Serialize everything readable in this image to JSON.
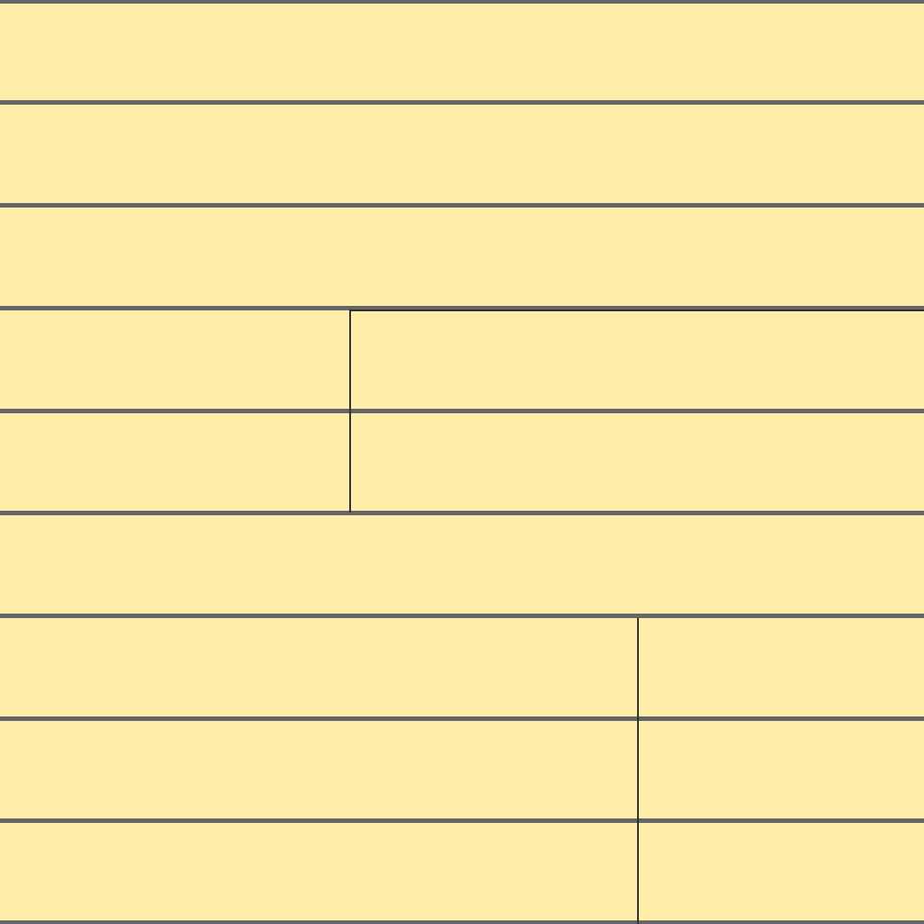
{
  "colors": {
    "background": "#ffedaa",
    "rule": "#666666",
    "divider": "#333333"
  },
  "rules": [
    "r0",
    "r1",
    "r2",
    "r3",
    "r4",
    "r5",
    "r6",
    "r7",
    "r8",
    "r9"
  ]
}
